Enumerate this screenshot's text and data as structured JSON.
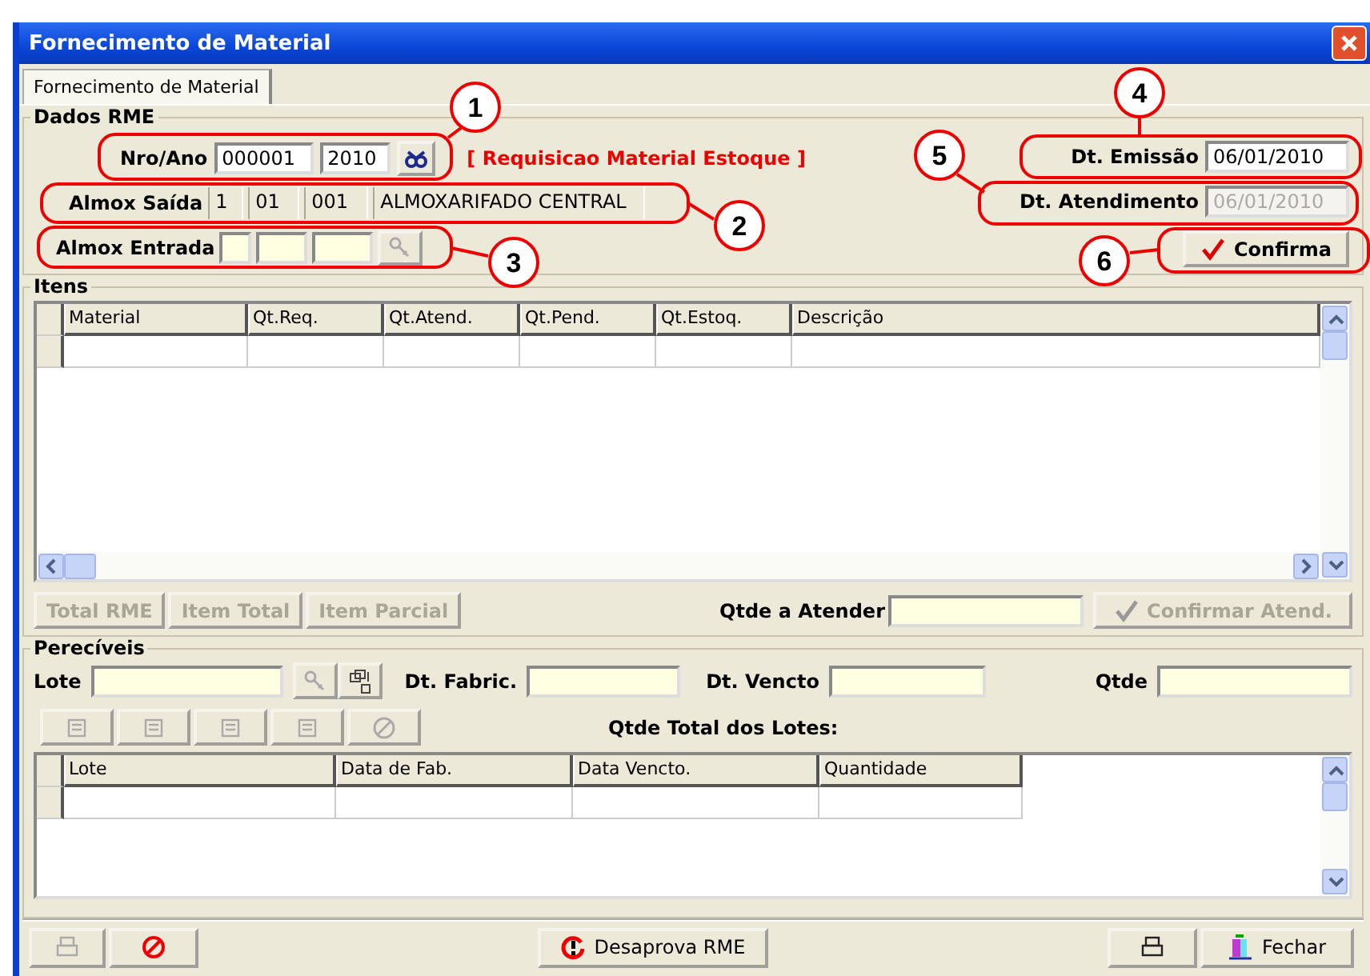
{
  "window": {
    "title": "Fornecimento de Material"
  },
  "tabs": [
    {
      "label": "Fornecimento de Material",
      "selected": true
    }
  ],
  "dados_rme": {
    "title": "Dados RME",
    "nro_ano": {
      "label": "Nro/Ano",
      "numero": "000001",
      "ano": "2010"
    },
    "requisicao_tipo": "[ Requisicao Material Estoque ]",
    "almox_saida": {
      "label": "Almox Saída",
      "values": [
        "1",
        "01",
        "001",
        "ALMOXARIFADO CENTRAL"
      ]
    },
    "almox_entrada": {
      "label": "Almox Entrada"
    },
    "dt_emissao": {
      "label": "Dt. Emissão",
      "value": "06/01/2010",
      "disabled": false
    },
    "dt_atendimento": {
      "label": "Dt. Atendimento",
      "value": "06/01/2010",
      "disabled": true
    },
    "confirma_button": {
      "label": "Confirma",
      "disabled": false
    }
  },
  "itens": {
    "title": "Itens",
    "columns": [
      "Material",
      "Qt.Req.",
      "Qt.Atend.",
      "Qt.Pend.",
      "Qt.Estoq.",
      "Descrição"
    ],
    "buttons": [
      {
        "label": "Total RME",
        "disabled": true
      },
      {
        "label": "Item Total",
        "disabled": true
      },
      {
        "label": "Item Parcial",
        "disabled": true
      }
    ],
    "qtde_label": "Qtde a Atender",
    "confirmar_button": {
      "label": "Confirmar Atend.",
      "disabled": true
    }
  },
  "pereciveis": {
    "title": "Perecíveis",
    "lote_label": "Lote",
    "fabric_label": "Dt. Fabric.",
    "vencto_label": "Dt. Vencto",
    "qtde_label": "Qtde",
    "total_label": "Qtde Total dos Lotes:",
    "columns": [
      "Lote",
      "Data de Fab.",
      "Data Vencto.",
      "Quantidade"
    ]
  },
  "footer": {
    "desaprova_button": "Desaprova RME",
    "fechar_button": "Fechar"
  },
  "annotations": [
    "1",
    "2",
    "3",
    "4",
    "5",
    "6"
  ]
}
